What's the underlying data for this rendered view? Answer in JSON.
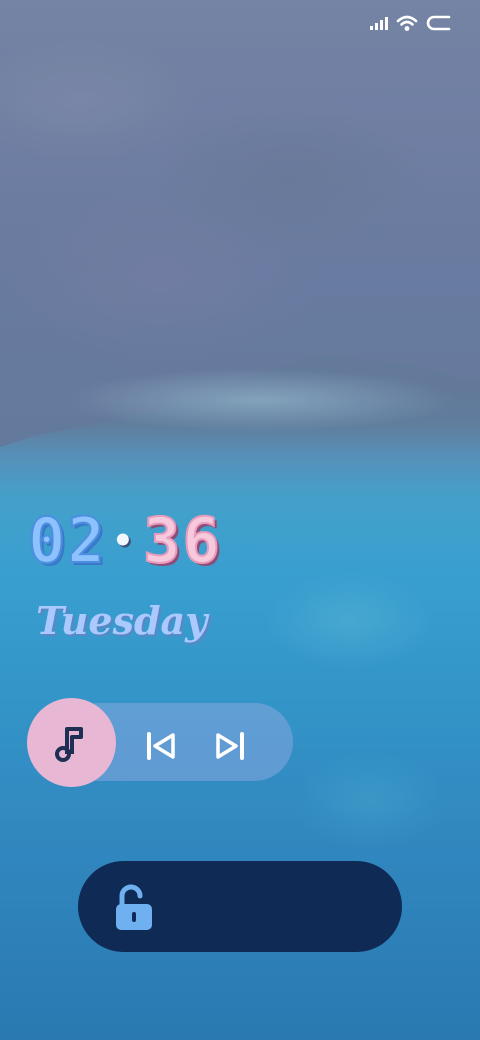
{
  "status": {
    "icons": [
      "signal-icon",
      "wifi-icon",
      "battery-icon"
    ],
    "signal_bars": 4,
    "battery_level": 0
  },
  "lockscreen": {
    "clock": {
      "hours": "02",
      "minutes": "36"
    },
    "weekday": "Tuesday"
  },
  "music": {
    "icons": [
      "music-note-icon",
      "skip-previous-icon",
      "skip-next-icon"
    ]
  },
  "unlock": {
    "icon": "unlock-icon"
  },
  "colors": {
    "hours": "#8ec2ff",
    "minutes": "#f6c9dc",
    "weekday": "#a9c9ff",
    "music_disc": "#e8b7d4",
    "unlock_bar": "#0f2a55",
    "unlock_icon": "#6fb0f0"
  }
}
